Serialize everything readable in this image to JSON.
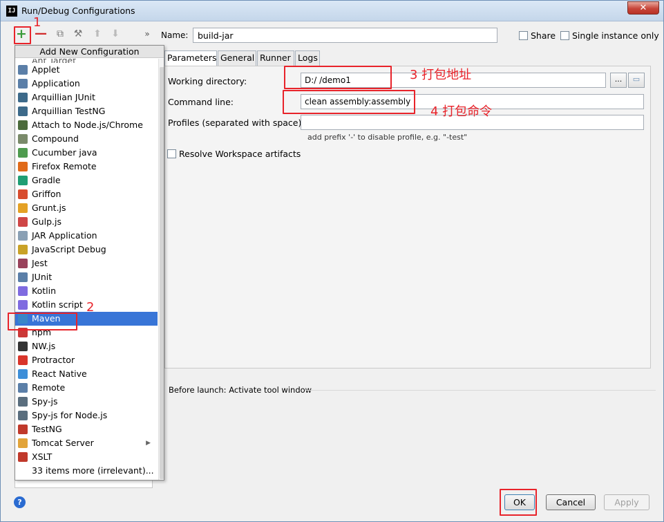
{
  "window": {
    "title": "Run/Debug Configurations",
    "icon": "IJ",
    "close": "✕"
  },
  "toolbar": {
    "add": "+",
    "remove": "—",
    "copy": "⧉",
    "edit": "⚒",
    "up": "⬆",
    "down": "⬇",
    "more": "»"
  },
  "name": {
    "label": "Name:",
    "value": "build-jar"
  },
  "options": {
    "share": "Share",
    "single_instance": "Single instance only"
  },
  "popup": {
    "header": "Add New Configuration",
    "first_partial": "Ant Target",
    "items": [
      {
        "label": "Applet",
        "icon": "applet-icon",
        "color": "#5b7fa8"
      },
      {
        "label": "Application",
        "icon": "application-icon",
        "color": "#5b7fa8"
      },
      {
        "label": "Arquillian JUnit",
        "icon": "arquillian-icon",
        "color": "#3d6a8a"
      },
      {
        "label": "Arquillian TestNG",
        "icon": "arquillian-icon",
        "color": "#3d6a8a"
      },
      {
        "label": "Attach to Node.js/Chrome",
        "icon": "nodejs-icon",
        "color": "#4c6b3c"
      },
      {
        "label": "Compound",
        "icon": "compound-icon",
        "color": "#7a8a6a"
      },
      {
        "label": "Cucumber java",
        "icon": "cucumber-icon",
        "color": "#4f9b4f"
      },
      {
        "label": "Firefox Remote",
        "icon": "firefox-icon",
        "color": "#e06a1a"
      },
      {
        "label": "Gradle",
        "icon": "gradle-icon",
        "color": "#1f9e74"
      },
      {
        "label": "Griffon",
        "icon": "griffon-icon",
        "color": "#d84c2e"
      },
      {
        "label": "Grunt.js",
        "icon": "grunt-icon",
        "color": "#e4a125"
      },
      {
        "label": "Gulp.js",
        "icon": "gulp-icon",
        "color": "#cf4646"
      },
      {
        "label": "JAR Application",
        "icon": "jar-icon",
        "color": "#8aa0b4"
      },
      {
        "label": "JavaScript Debug",
        "icon": "js-debug-icon",
        "color": "#c9a227"
      },
      {
        "label": "Jest",
        "icon": "jest-icon",
        "color": "#99425b"
      },
      {
        "label": "JUnit",
        "icon": "junit-icon",
        "color": "#5b7fa8"
      },
      {
        "label": "Kotlin",
        "icon": "kotlin-icon",
        "color": "#7f6be0"
      },
      {
        "label": "Kotlin script",
        "icon": "kotlin-icon",
        "color": "#7f6be0"
      },
      {
        "label": "Maven",
        "icon": "maven-icon",
        "color": "#3a86c8",
        "selected": true
      },
      {
        "label": "npm",
        "icon": "npm-icon",
        "color": "#cb3837"
      },
      {
        "label": "NW.js",
        "icon": "nwjs-icon",
        "color": "#333333"
      },
      {
        "label": "Protractor",
        "icon": "protractor-icon",
        "color": "#d9352b"
      },
      {
        "label": "React Native",
        "icon": "react-icon",
        "color": "#3d8ed8"
      },
      {
        "label": "Remote",
        "icon": "remote-icon",
        "color": "#5b7fa8"
      },
      {
        "label": "Spy-js",
        "icon": "spyjs-icon",
        "color": "#5a6e7e"
      },
      {
        "label": "Spy-js for Node.js",
        "icon": "spyjs-icon",
        "color": "#5a6e7e"
      },
      {
        "label": "TestNG",
        "icon": "testng-icon",
        "color": "#c0392b"
      },
      {
        "label": "Tomcat Server",
        "icon": "tomcat-icon",
        "color": "#e2a43a",
        "submenu": true
      },
      {
        "label": "XSLT",
        "icon": "xslt-icon",
        "color": "#c0392b"
      },
      {
        "label": "33 items more (irrelevant)...",
        "icon": "",
        "color": ""
      }
    ]
  },
  "tabs": [
    "Parameters",
    "General",
    "Runner",
    "Logs"
  ],
  "params": {
    "working_dir_label": "Working directory:",
    "working_dir_value": "D:/        /demo1",
    "command_label": "Command line:",
    "command_value": "clean assembly:assembly",
    "profiles_label": "Profiles (separated with space):",
    "profiles_value": "",
    "profiles_hint": "add prefix '-' to disable profile, e.g. \"-test\"",
    "resolve_label": "Resolve Workspace artifacts",
    "browse": "...",
    "folder": "▭"
  },
  "before_launch": "Before launch: Activate tool window",
  "buttons": {
    "help": "?",
    "ok": "OK",
    "cancel": "Cancel",
    "apply": "Apply"
  },
  "annotations": {
    "n1": "1",
    "n2": "2",
    "n3": "3 打包地址",
    "n4": "4 打包命令",
    "color": "#e8232a"
  }
}
